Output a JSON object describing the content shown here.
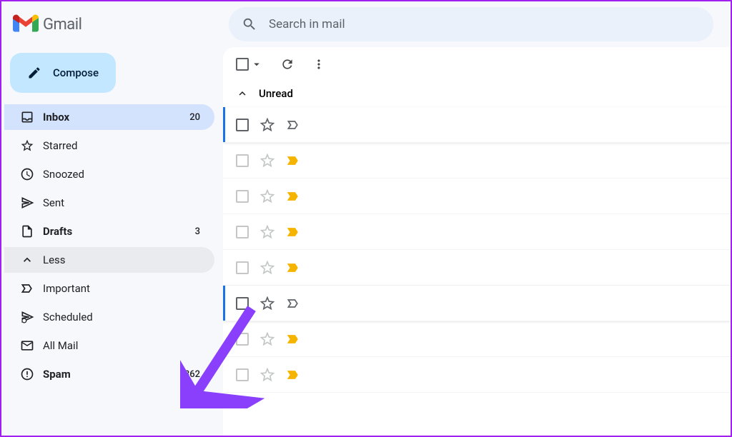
{
  "header": {
    "app_name": "Gmail",
    "search_placeholder": "Search in mail"
  },
  "compose_label": "Compose",
  "nav": [
    {
      "key": "inbox",
      "label": "Inbox",
      "count": "20",
      "active": true,
      "bold": true
    },
    {
      "key": "starred",
      "label": "Starred",
      "count": "",
      "active": false,
      "bold": false
    },
    {
      "key": "snoozed",
      "label": "Snoozed",
      "count": "",
      "active": false,
      "bold": false
    },
    {
      "key": "sent",
      "label": "Sent",
      "count": "",
      "active": false,
      "bold": false
    },
    {
      "key": "drafts",
      "label": "Drafts",
      "count": "3",
      "active": false,
      "bold": true
    },
    {
      "key": "less",
      "label": "Less",
      "count": "",
      "active": false,
      "bold": false,
      "expanded": true
    },
    {
      "key": "important",
      "label": "Important",
      "count": "",
      "active": false,
      "bold": false
    },
    {
      "key": "scheduled",
      "label": "Scheduled",
      "count": "",
      "active": false,
      "bold": false
    },
    {
      "key": "allmail",
      "label": "All Mail",
      "count": "",
      "active": false,
      "bold": false
    },
    {
      "key": "spam",
      "label": "Spam",
      "count": "362",
      "active": false,
      "bold": true
    }
  ],
  "section_header": "Unread",
  "emails": [
    {
      "selected": true,
      "starred": false,
      "tag_yellow": false
    },
    {
      "selected": false,
      "starred": false,
      "tag_yellow": true
    },
    {
      "selected": false,
      "starred": false,
      "tag_yellow": true
    },
    {
      "selected": false,
      "starred": false,
      "tag_yellow": true
    },
    {
      "selected": false,
      "starred": false,
      "tag_yellow": true
    },
    {
      "selected": true,
      "starred": false,
      "tag_yellow": false
    },
    {
      "selected": false,
      "starred": false,
      "tag_yellow": true
    },
    {
      "selected": false,
      "starred": false,
      "tag_yellow": true
    }
  ]
}
